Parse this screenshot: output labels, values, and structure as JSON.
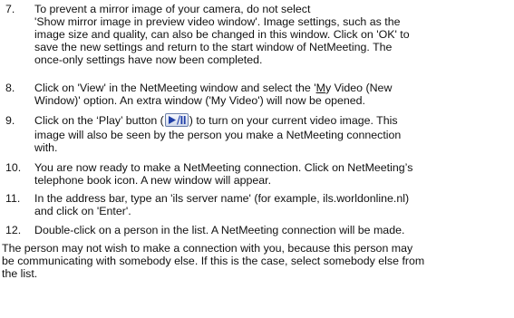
{
  "steps": [
    {
      "number": "7.",
      "lines": [
        "To prevent a mirror image of your camera, do not select",
        "'Show mirror image in preview video window'. Image settings, such as the",
        "image size and quality, can also be changed in this window. Click on 'OK' to",
        "save the new settings and return to the start window of NetMeeting. The",
        "once-only settings have now been completed."
      ]
    },
    {
      "number": "8.",
      "line1_pre": "Click on 'View' in the NetMeeting window and select the '",
      "line1_u": "M",
      "line1_post": "y Video (New",
      "line2": "Window)' option. An extra window ('My Video') will now be opened."
    },
    {
      "number": "9.",
      "line1_pre": "Click on the ‘Play’ button (",
      "line1_post": ") to turn on your current video image. This",
      "line2": "image will also be seen by the person you make a NetMeeting connection",
      "line3": "with.",
      "button_icon": "play-pause-icon",
      "button_color": "#1f3fa8"
    },
    {
      "number": "10.",
      "lines": [
        "You are now ready to make a NetMeeting connection. Click on NetMeeting’s",
        "telephone book icon. A new window will appear."
      ]
    },
    {
      "number": "11.",
      "lines": [
        "In the address bar, type an 'ils server name' (for example, ils.worldonline.nl)",
        "and click on 'Enter'."
      ]
    },
    {
      "number": "12.",
      "lines": [
        "Double-click on a person in the list. A NetMeeting connection will be made."
      ]
    }
  ],
  "closing": {
    "lines": [
      "The person may not wish to make a connection with you, because this person may",
      "be communicating with somebody else. If this is the case, select somebody else from",
      "the list."
    ]
  }
}
